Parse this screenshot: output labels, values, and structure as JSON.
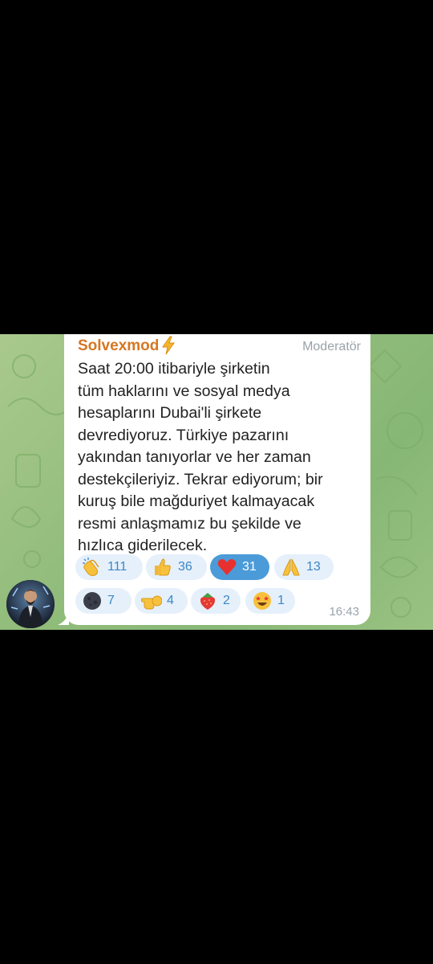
{
  "message": {
    "sender": "Solvexmod",
    "role": "Moderatör",
    "text_lines": [
      "Saat 20:00 itibariyle şirketin",
      "tüm haklarını ve sosyal medya",
      "hesaplarını Dubai'li şirkete",
      "devrediyoruz. Türkiye pazarını",
      "yakından tanıyorlar ve her zaman",
      "destekçileriyiz. Tekrar ediyorum; bir",
      "kuruş bile mağduriyet kalmayacak",
      "resmi anlaşmamız bu şekilde ve",
      "hızlıca giderilecek."
    ],
    "time": "16:43"
  },
  "reactions": [
    {
      "icon": "clapping-hands-icon",
      "count": "111",
      "selected": false
    },
    {
      "icon": "thumbs-up-icon",
      "count": "36",
      "selected": false
    },
    {
      "icon": "red-heart-icon",
      "count": "31",
      "selected": true
    },
    {
      "icon": "folded-hands-icon",
      "count": "13",
      "selected": false
    },
    {
      "icon": "new-moon-face-icon",
      "count": "7",
      "selected": false
    },
    {
      "icon": "pointing-hand-icon",
      "count": "4",
      "selected": false
    },
    {
      "icon": "strawberry-icon",
      "count": "2",
      "selected": false
    },
    {
      "icon": "star-struck-icon",
      "count": "1",
      "selected": false
    }
  ],
  "avatar": {
    "label": "SOLVEX"
  },
  "colors": {
    "sender_name": "#d67722",
    "chat_background": "#93bd7c",
    "reaction_bg": "#e5f0fb",
    "reaction_selected_bg": "#4b9bd8",
    "reaction_count": "#3d86c6"
  }
}
